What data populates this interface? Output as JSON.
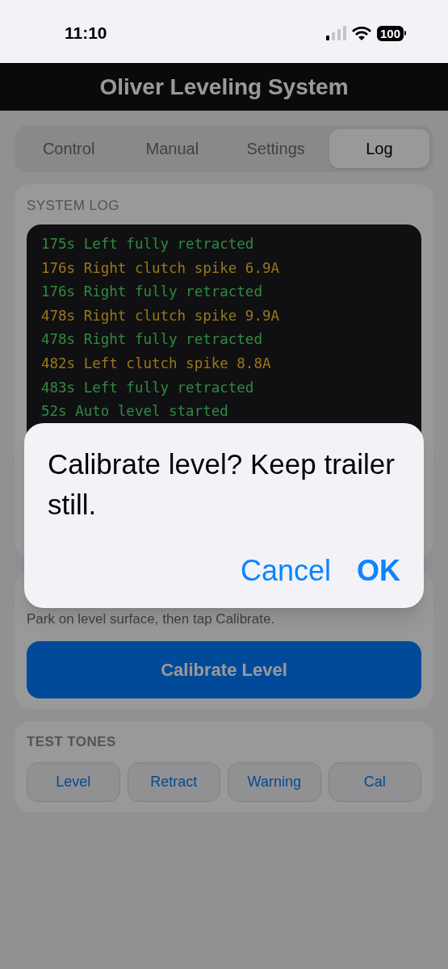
{
  "status_bar": {
    "time": "11:10",
    "battery": "100"
  },
  "header": {
    "title": "Oliver Leveling System"
  },
  "tabs": [
    {
      "label": "Control",
      "selected": false
    },
    {
      "label": "Manual",
      "selected": false
    },
    {
      "label": "Settings",
      "selected": false
    },
    {
      "label": "Log",
      "selected": true
    }
  ],
  "system_log": {
    "heading": "SYSTEM LOG",
    "entries": [
      {
        "text": "175s Left fully retracted",
        "kind": "ok"
      },
      {
        "text": "176s Right clutch spike 6.9A",
        "kind": "warn"
      },
      {
        "text": "176s Right fully retracted",
        "kind": "ok"
      },
      {
        "text": "478s Right clutch spike 9.9A",
        "kind": "warn"
      },
      {
        "text": "478s Right fully retracted",
        "kind": "ok"
      },
      {
        "text": "482s Left clutch spike 8.8A",
        "kind": "warn"
      },
      {
        "text": "483s Left fully retracted",
        "kind": "ok"
      },
      {
        "text": "52s Auto level started",
        "kind": "ok"
      }
    ]
  },
  "calibration": {
    "hint": "Park on level surface, then tap Calibrate.",
    "button": "Calibrate Level"
  },
  "test_tones": {
    "heading": "TEST TONES",
    "buttons": [
      "Level",
      "Retract",
      "Warning",
      "Cal"
    ]
  },
  "dialog": {
    "message": "Calibrate level? Keep trailer still.",
    "buttons": [
      {
        "label": "Cancel",
        "kind": "cancel"
      },
      {
        "label": "OK",
        "kind": "confirm"
      }
    ]
  }
}
